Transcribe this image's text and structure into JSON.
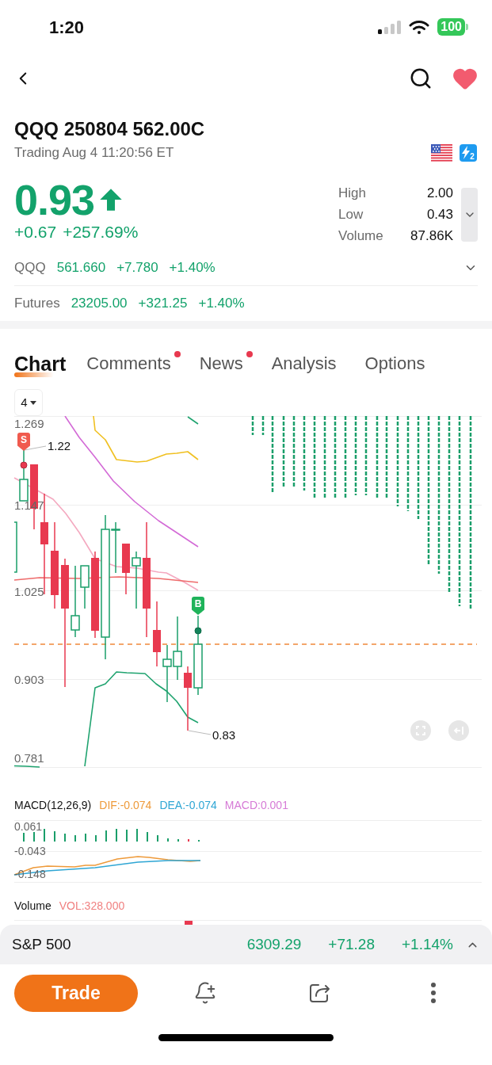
{
  "status_bar": {
    "time": "1:20",
    "battery": "100"
  },
  "header": {
    "title": "QQQ 250804 562.00C",
    "subtitle": "Trading Aug 4 11:20:56 ET",
    "level_badge": "2"
  },
  "quote": {
    "price": "0.93",
    "change": "+0.67",
    "change_percent": "+257.69%",
    "stats": [
      {
        "label": "High",
        "value": "2.00"
      },
      {
        "label": "Low",
        "value": "0.43"
      },
      {
        "label": "Volume",
        "value": "87.86K"
      }
    ]
  },
  "related": [
    {
      "label": "QQQ",
      "price": "561.660",
      "change": "+7.780",
      "change_percent": "+1.40%",
      "expandable": true
    },
    {
      "label": "Futures",
      "price": "23205.00",
      "change": "+321.25",
      "change_percent": "+1.40%",
      "expandable": false
    }
  ],
  "tabs": [
    {
      "label": "Chart",
      "selected": true,
      "unread": false
    },
    {
      "label": "Comments",
      "selected": false,
      "unread": true
    },
    {
      "label": "News",
      "selected": false,
      "unread": true
    },
    {
      "label": "Analysis",
      "selected": false,
      "unread": false
    },
    {
      "label": "Options",
      "selected": false,
      "unread": false
    }
  ],
  "chart": {
    "period": "4",
    "y_axis_labels": [
      "1.269",
      "1.147",
      "1.025",
      "0.903",
      "0.781"
    ],
    "sell_marker": "S",
    "buy_marker": "B",
    "high_label": "1.22",
    "low_label": "0.83"
  },
  "macd": {
    "title": "MACD(12,26,9)",
    "dif": "DIF:-0.074",
    "dea": "DEA:-0.074",
    "macd": "MACD:0.001",
    "y_axis_labels": [
      "0.061",
      "-0.043",
      "-0.148"
    ]
  },
  "volume": {
    "title": "Volume",
    "reading": "VOL:328.000"
  },
  "index_bar": {
    "name": "S&P 500",
    "price": "6309.29",
    "change": "+71.28",
    "change_percent": "+1.14%"
  },
  "actions": {
    "trade": "Trade"
  }
}
